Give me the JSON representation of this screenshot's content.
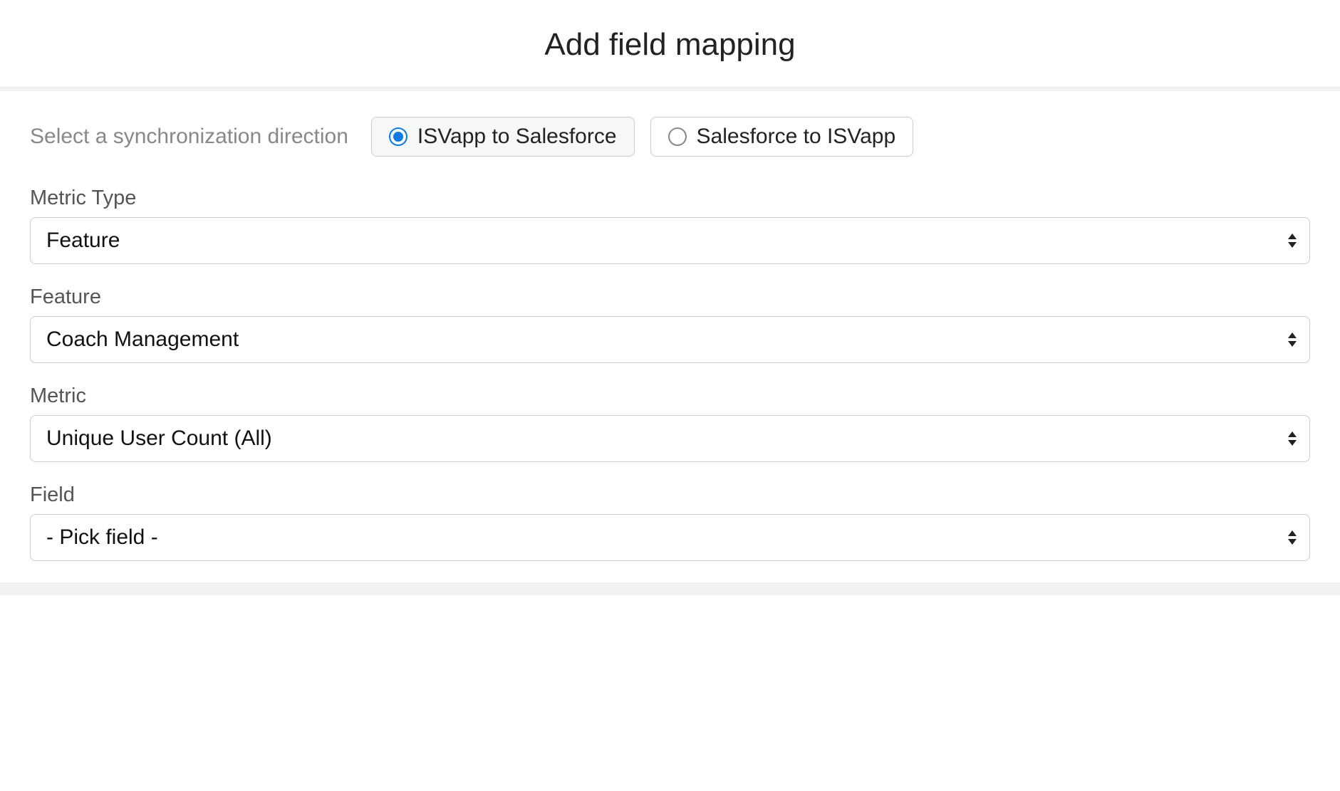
{
  "header": {
    "title": "Add field mapping"
  },
  "sync": {
    "label": "Select a synchronization direction",
    "options": [
      {
        "label": "ISVapp to Salesforce",
        "selected": true
      },
      {
        "label": "Salesforce to ISVapp",
        "selected": false
      }
    ]
  },
  "form": {
    "metricType": {
      "label": "Metric Type",
      "value": "Feature"
    },
    "feature": {
      "label": "Feature",
      "value": "Coach Management"
    },
    "metric": {
      "label": "Metric",
      "value": "Unique User Count (All)"
    },
    "field": {
      "label": "Field",
      "value": "- Pick field -"
    }
  }
}
